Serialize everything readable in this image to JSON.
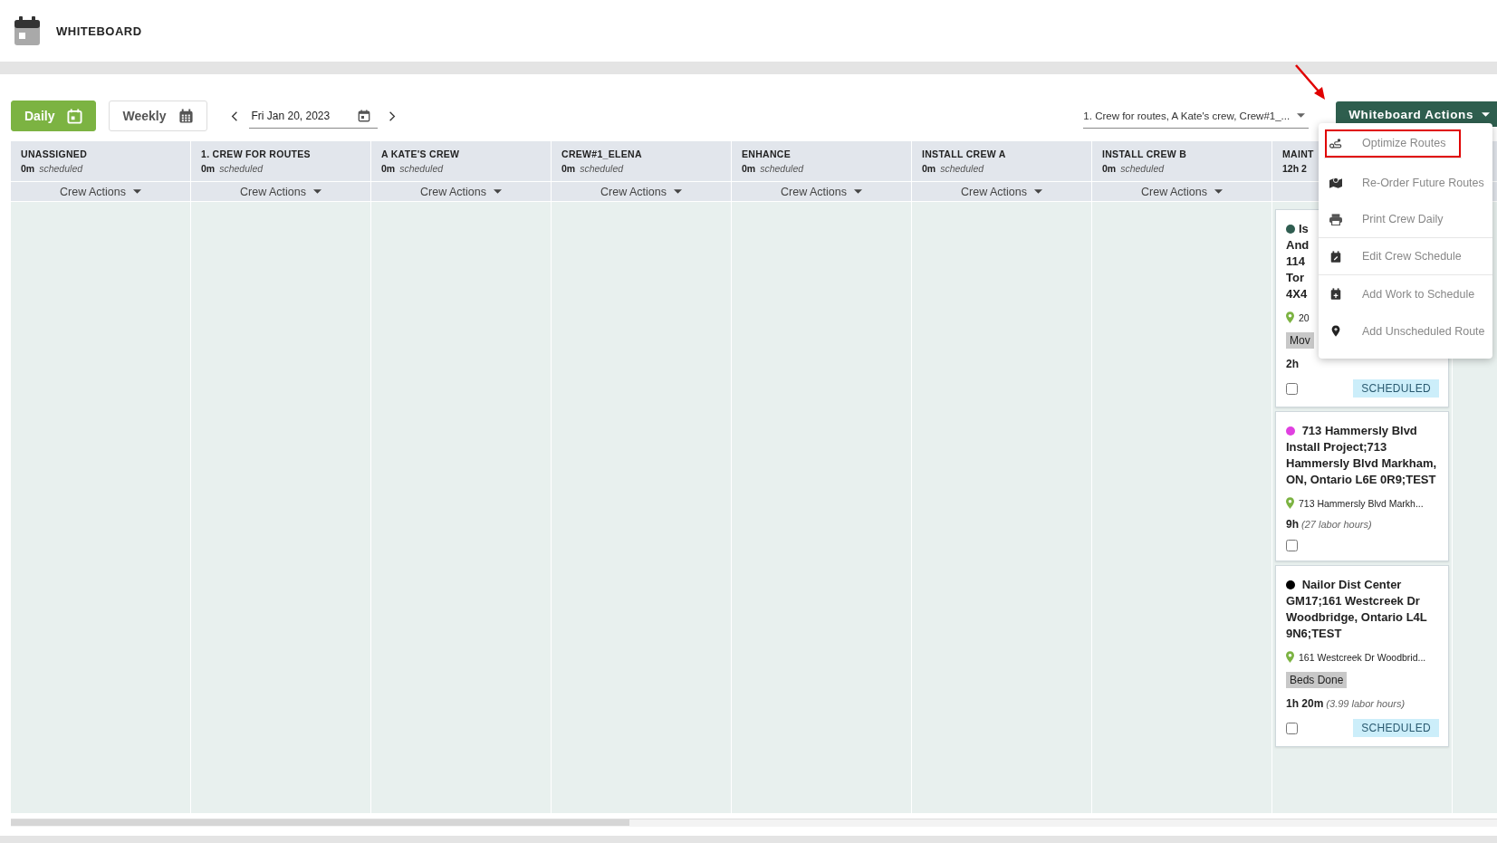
{
  "page": {
    "title": "WHITEBOARD"
  },
  "toolbar": {
    "views": [
      {
        "label": "Daily",
        "selected": true
      },
      {
        "label": "Weekly",
        "selected": false
      }
    ],
    "date": "Fri Jan 20, 2023",
    "crew_filter": "1. Crew for routes, A Kate's crew, Crew#1_...",
    "actions_button": "Whiteboard Actions"
  },
  "columns": [
    {
      "name": "UNASSIGNED",
      "duration": "0m",
      "scheduled": "scheduled",
      "actions": "Crew Actions"
    },
    {
      "name": "1. CREW FOR ROUTES",
      "duration": "0m",
      "scheduled": "scheduled",
      "actions": "Crew Actions"
    },
    {
      "name": "A KATE'S CREW",
      "duration": "0m",
      "scheduled": "scheduled",
      "actions": "Crew Actions"
    },
    {
      "name": "CREW#1_ELENA",
      "duration": "0m",
      "scheduled": "scheduled",
      "actions": "Crew Actions"
    },
    {
      "name": "ENHANCE",
      "duration": "0m",
      "scheduled": "scheduled",
      "actions": "Crew Actions"
    },
    {
      "name": "INSTALL CREW A",
      "duration": "0m",
      "scheduled": "scheduled",
      "actions": "Crew Actions"
    },
    {
      "name": "INSTALL CREW B",
      "duration": "0m",
      "scheduled": "scheduled",
      "actions": "Crew Actions"
    },
    {
      "name": "MAINT",
      "duration": "12h 2",
      "cards": [
        {
          "kind": "clipped",
          "color": "#2f5d50",
          "lines": [
            "Is",
            "And",
            "114",
            "Tor",
            "4X4"
          ],
          "location": "20",
          "tag": "Mov",
          "duration": "2h",
          "checked": false,
          "status": "SCHEDULED"
        },
        {
          "kind": "full",
          "color": "#e040e0",
          "title": "713 Hammersly Blvd Install Project;713 Hammersly Blvd Markham, ON, Ontario L6E 0R9;TEST",
          "location": "713 Hammersly Blvd Markh...",
          "duration": "9h",
          "labor": "(27 labor hours)",
          "checked": false
        },
        {
          "kind": "full",
          "color": "#000000",
          "title": "Nailor Dist Center GM17;161 Westcreek Dr Woodbridge, Ontario L4L 9N6;TEST",
          "location": "161 Westcreek Dr Woodbrid...",
          "tag": "Beds Done",
          "duration": "1h 20m",
          "labor": "(3.99 labor hours)",
          "checked": false,
          "status": "SCHEDULED"
        }
      ]
    },
    {}
  ],
  "actions_menu": [
    {
      "kind": "optimize",
      "label": "Optimize Routes",
      "selected": true
    },
    {
      "kind": "reorder",
      "label": "Re-Order Future Routes",
      "selected": false
    },
    {
      "kind": "print",
      "label": "Print Crew Daily",
      "selected": false
    },
    {
      "kind": "edit",
      "label": "Edit Crew Schedule",
      "selected": false
    },
    {
      "kind": "add",
      "label": "Add Work to Schedule",
      "selected": false
    },
    {
      "kind": "pin",
      "label": "Add Unscheduled Route",
      "selected": false
    }
  ]
}
